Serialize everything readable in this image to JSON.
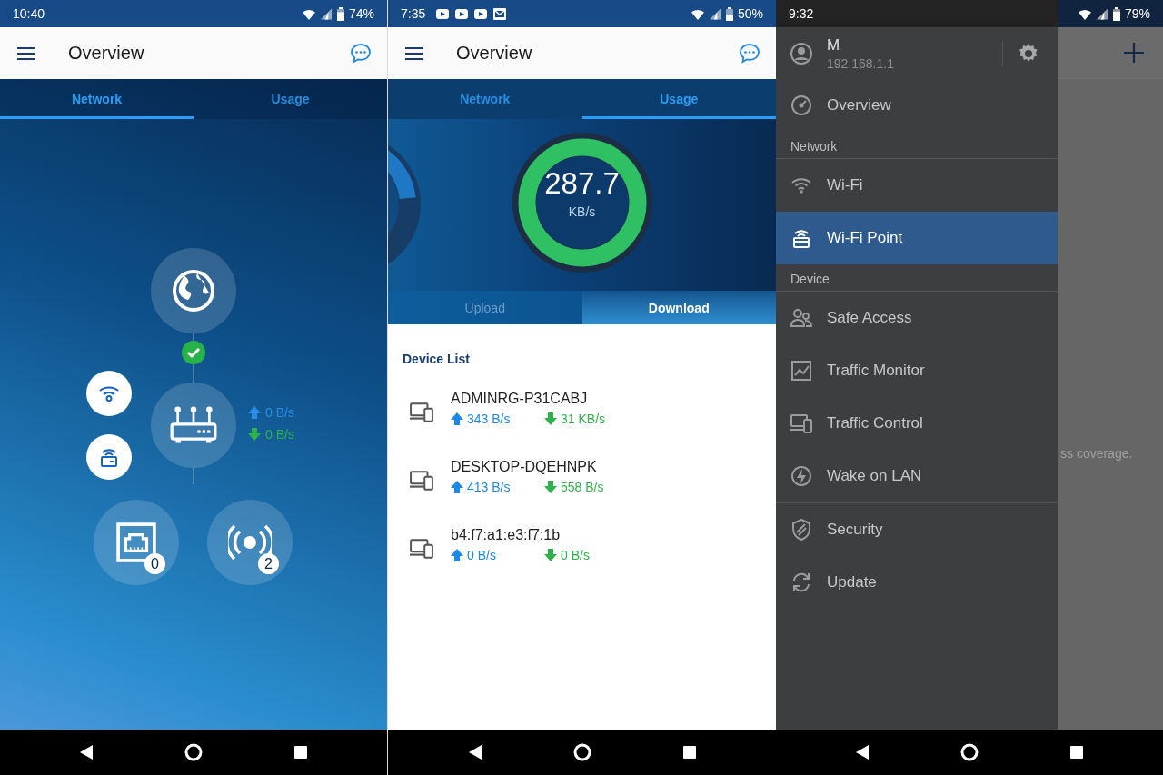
{
  "screens": [
    {
      "kind": "network",
      "status": {
        "time": "10:40",
        "battery": "74%"
      },
      "title": "Overview",
      "tabs": [
        {
          "label": "Network",
          "selected": true
        },
        {
          "label": "Usage",
          "selected": false
        }
      ],
      "topology": {
        "internet_connected": true,
        "router_upload": "0 B/s",
        "router_download": "0 B/s",
        "wired_count": "0",
        "wireless_count": "2"
      }
    },
    {
      "kind": "usage",
      "status": {
        "time": "7:35",
        "notifications": [
          {
            "kind": "video"
          },
          {
            "kind": "video"
          },
          {
            "kind": "video"
          },
          {
            "kind": "mail"
          }
        ],
        "battery": "50%"
      },
      "title": "Overview",
      "tabs": [
        {
          "label": "Network",
          "selected": false
        },
        {
          "label": "Usage",
          "selected": true
        }
      ],
      "gauge": {
        "value": "287.7",
        "unit": "KB/s"
      },
      "modes": [
        {
          "label": "Upload",
          "selected": false
        },
        {
          "label": "Download",
          "selected": true
        }
      ],
      "device_list": {
        "title": "Device List",
        "devices": [
          {
            "name": "ADMINRG-P31CABJ",
            "upload": "343 B/s",
            "download": "31 KB/s"
          },
          {
            "name": "DESKTOP-DQEHNPK",
            "upload": "413 B/s",
            "download": "558 B/s"
          },
          {
            "name": "b4:f7:a1:e3:f7:1b",
            "upload": "0 B/s",
            "download": "0 B/s"
          }
        ]
      }
    },
    {
      "kind": "drawer",
      "status": {
        "time": "9:32",
        "battery": "79%"
      },
      "background_text": "ss coverage.",
      "drawer": {
        "user": "M",
        "address": "192.168.1.1",
        "items": [
          {
            "kind": "item",
            "label": "Overview",
            "selected": false
          },
          {
            "kind": "section",
            "label": "Network"
          },
          {
            "kind": "item",
            "label": "Wi-Fi",
            "selected": false
          },
          {
            "kind": "item",
            "label": "Wi-Fi Point",
            "selected": true
          },
          {
            "kind": "section",
            "label": "Device"
          },
          {
            "kind": "item",
            "label": "Safe Access",
            "selected": false
          },
          {
            "kind": "item",
            "label": "Traffic Monitor",
            "selected": false
          },
          {
            "kind": "item",
            "label": "Traffic Control",
            "selected": false
          },
          {
            "kind": "item",
            "label": "Wake on LAN",
            "selected": false
          },
          {
            "kind": "divider"
          },
          {
            "kind": "item",
            "label": "Security",
            "selected": false
          },
          {
            "kind": "item",
            "label": "Update",
            "selected": false
          }
        ]
      }
    }
  ]
}
